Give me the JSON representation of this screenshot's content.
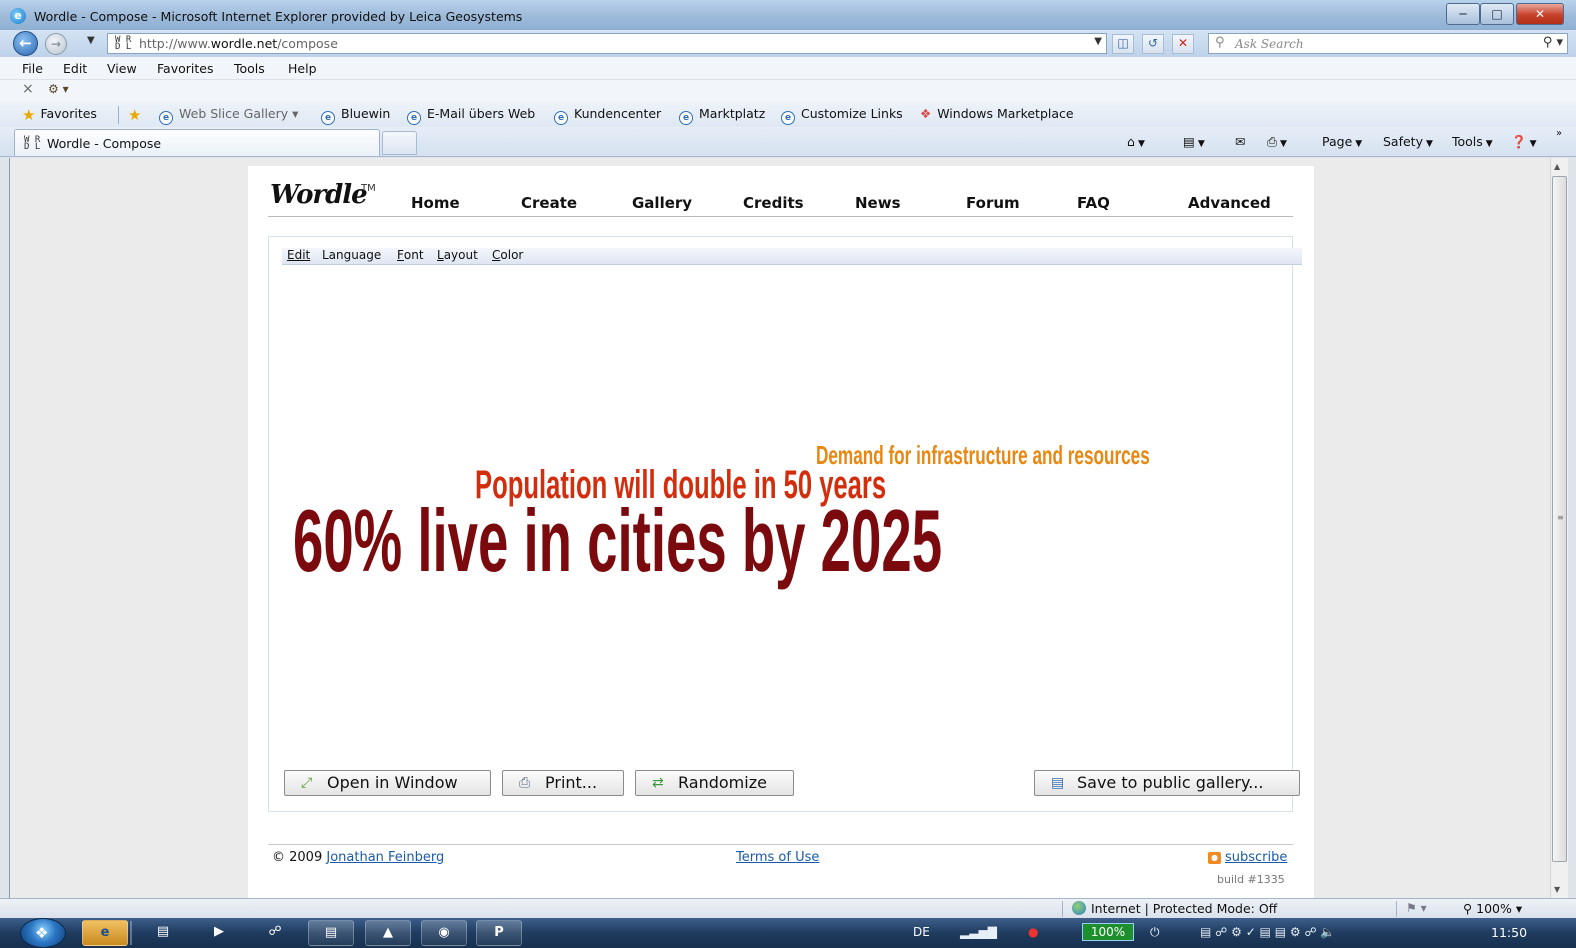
{
  "window": {
    "title": "Wordle - Compose - Microsoft Internet Explorer provided by Leica Geosystems"
  },
  "address_bar": {
    "url_prefix": "http://www.",
    "url_domain": "wordle.net",
    "url_path": "/compose",
    "search_placeholder": "Ask Search"
  },
  "menu_bar": {
    "items": [
      "File",
      "Edit",
      "View",
      "Favorites",
      "Tools",
      "Help"
    ]
  },
  "favorites_bar": {
    "label": "Favorites",
    "items": [
      "Web Slice Gallery",
      "Bluewin",
      "E-Mail übers Web",
      "Kundencenter",
      "Marktplatz",
      "Customize Links",
      "Windows Marketplace"
    ]
  },
  "tab": {
    "label": "Wordle - Compose"
  },
  "command_bar": {
    "items": [
      "Page",
      "Safety",
      "Tools"
    ]
  },
  "wordle": {
    "logo": "Wordle",
    "trademark": "TM",
    "nav": [
      "Home",
      "Create",
      "Gallery",
      "Credits",
      "News",
      "Forum",
      "FAQ",
      "Advanced"
    ],
    "applet_menu": {
      "edit": "Edit",
      "language": "Language",
      "font_first": "F",
      "font_rest": "ont",
      "layout_first": "L",
      "layout_rest": "ayout",
      "color_first": "C",
      "color_rest": "olor"
    },
    "cloud": {
      "line1": "Demand  for infrastructure and resources",
      "line2": "Population will double in 50 years",
      "line3": "60% live in cities by 2025",
      "colors": {
        "line1": "#e88711",
        "line2": "#d22e0e",
        "line3": "#7a0a0e"
      }
    },
    "buttons": {
      "open": "Open in Window",
      "print": "Print...",
      "randomize": "Randomize",
      "save": "Save to public gallery..."
    },
    "footer": {
      "copyright": "© 2009",
      "author": "Jonathan Feinberg",
      "terms": "Terms of Use",
      "subscribe": "subscribe",
      "build": "build #1335"
    }
  },
  "status_bar": {
    "zone": "Internet | Protected Mode: Off",
    "zoom": "100%"
  },
  "taskbar": {
    "language": "DE",
    "battery": "100%",
    "clock": "11:50"
  }
}
